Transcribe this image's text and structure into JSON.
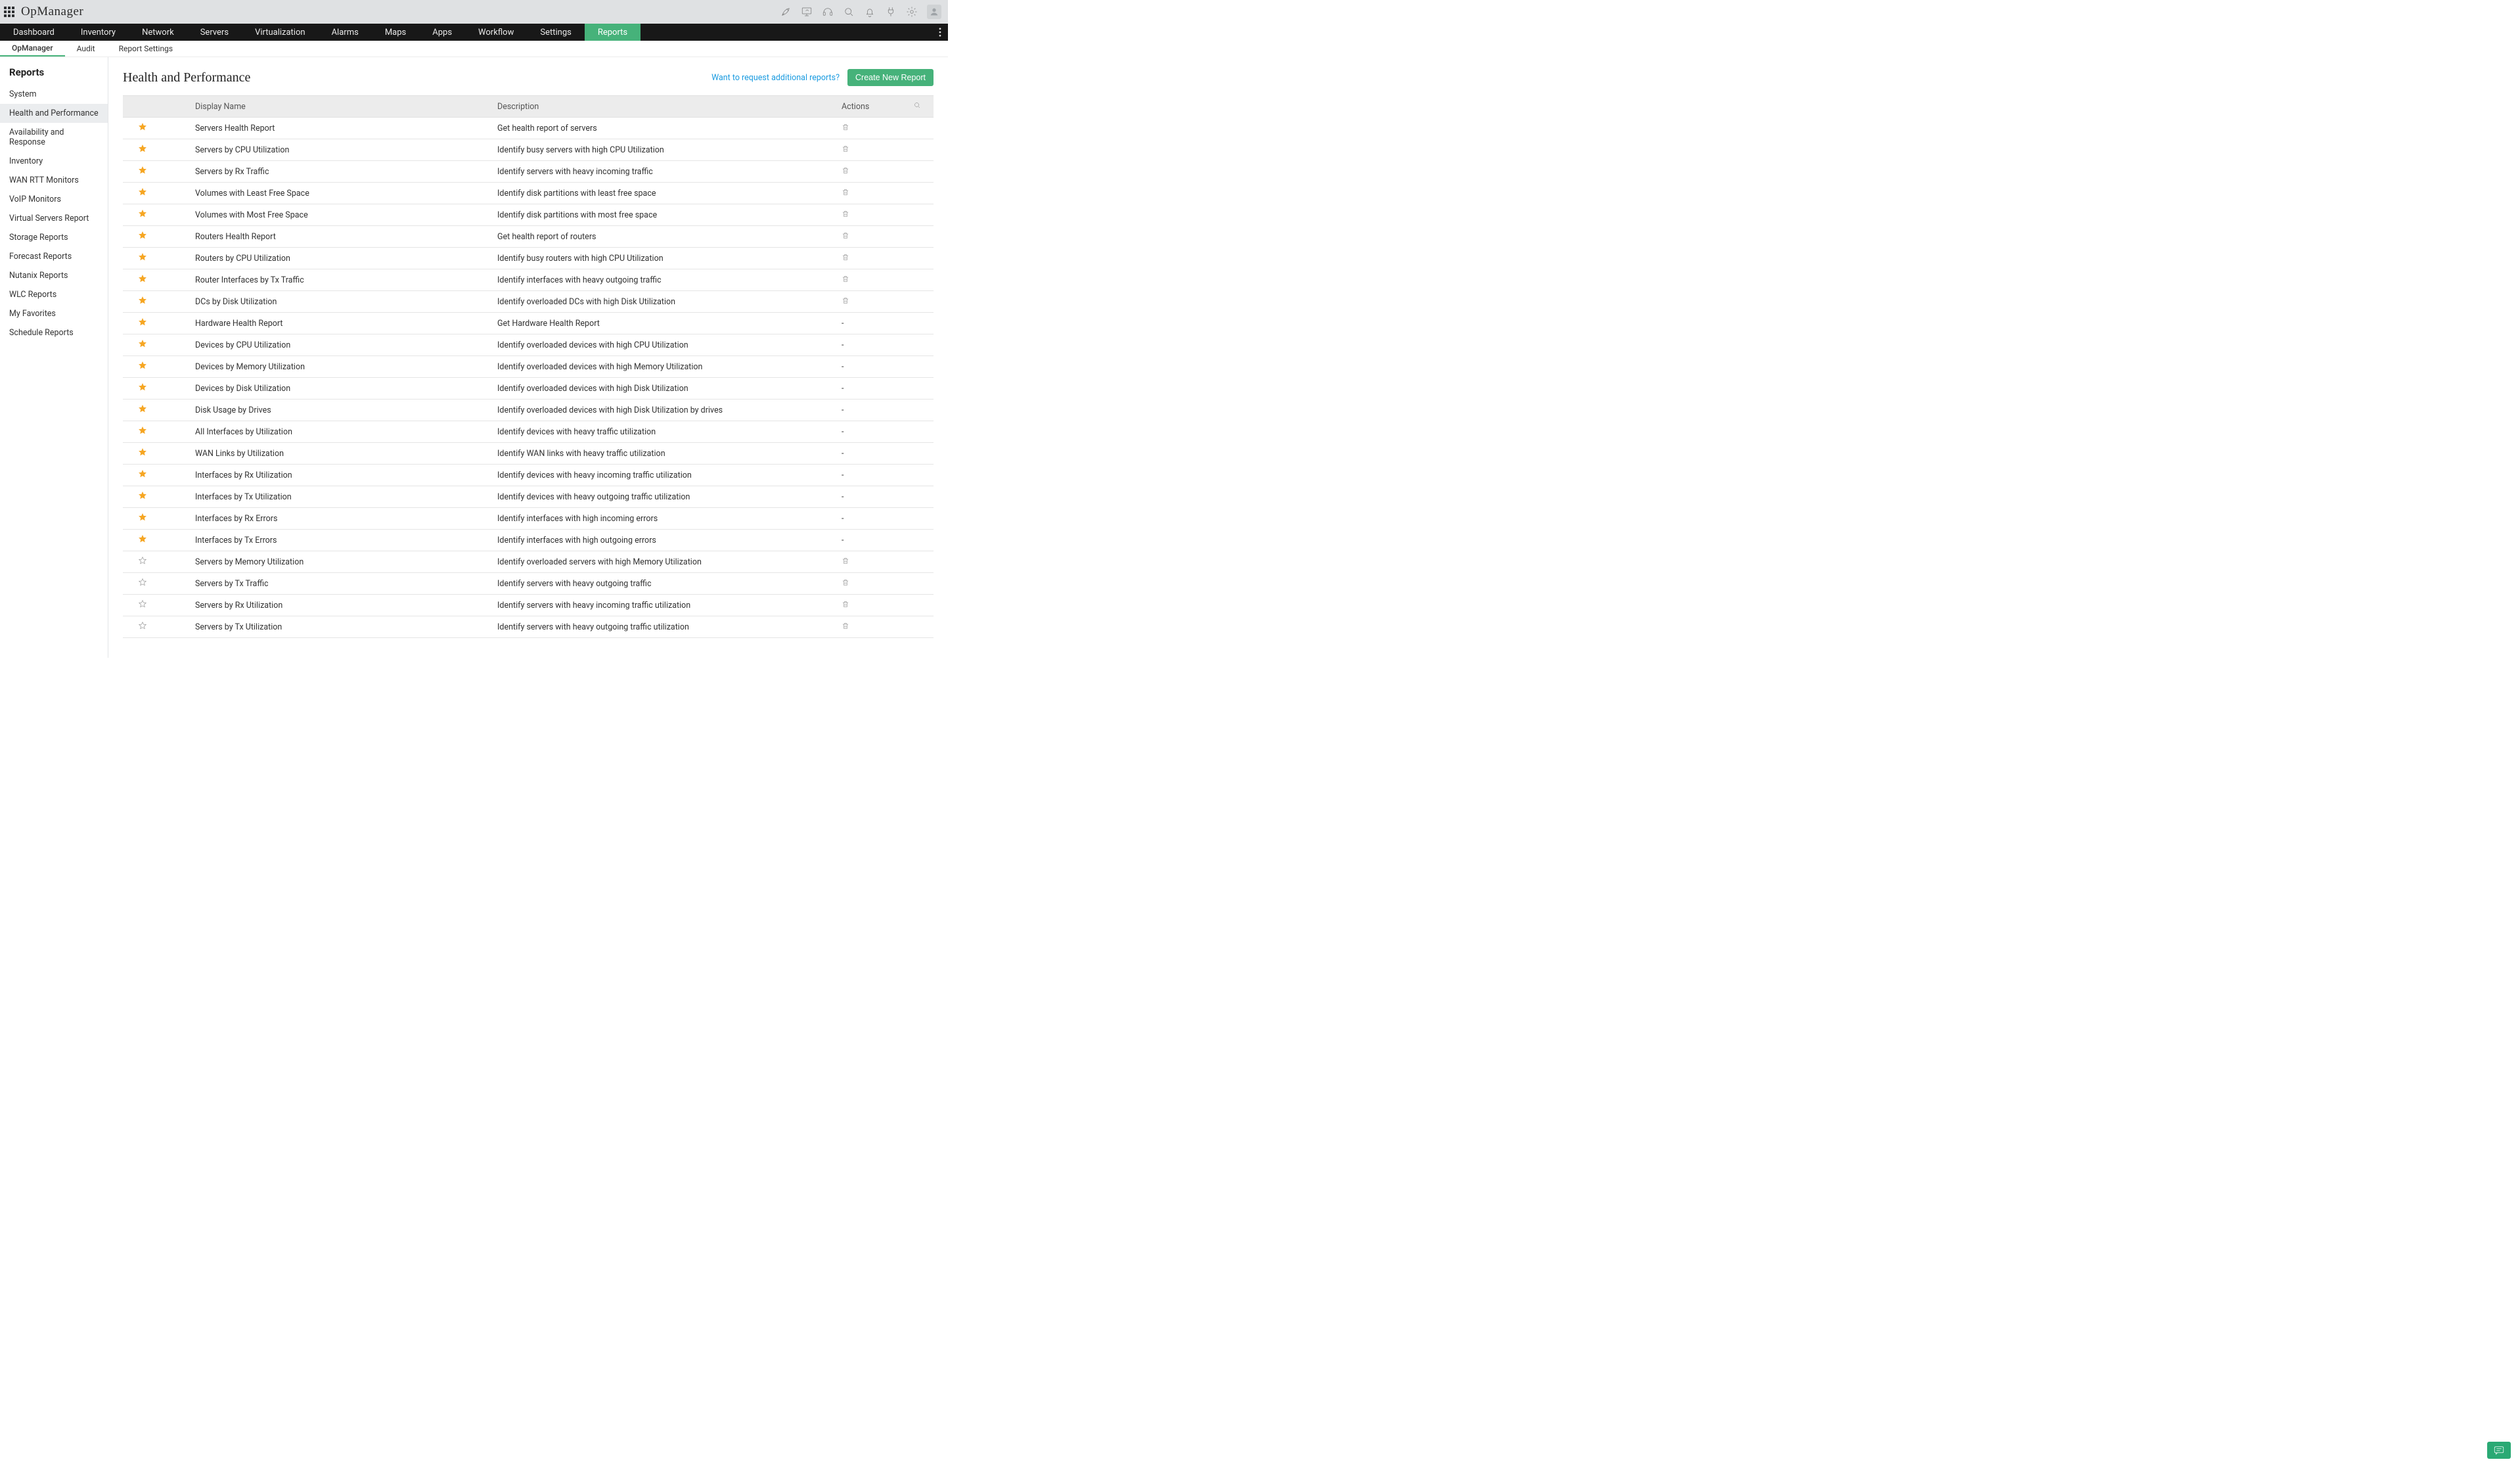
{
  "app": {
    "title": "OpManager"
  },
  "topbar_icons": [
    "rocket-icon",
    "monitor-icon",
    "headset-icon",
    "search-icon",
    "bell-icon",
    "plug-icon",
    "gear-icon",
    "user-icon"
  ],
  "mainnav": {
    "items": [
      "Dashboard",
      "Inventory",
      "Network",
      "Servers",
      "Virtualization",
      "Alarms",
      "Maps",
      "Apps",
      "Workflow",
      "Settings",
      "Reports"
    ],
    "active": "Reports"
  },
  "subnav": {
    "items": [
      "OpManager",
      "Audit",
      "Report Settings"
    ],
    "active": "OpManager"
  },
  "sidebar": {
    "title": "Reports",
    "items": [
      "System",
      "Health and Performance",
      "Availability and Response",
      "Inventory",
      "WAN RTT Monitors",
      "VoIP Monitors",
      "Virtual Servers Report",
      "Storage Reports",
      "Forecast Reports",
      "Nutanix Reports",
      "WLC Reports",
      "My Favorites",
      "Schedule Reports"
    ],
    "active": "Health and Performance"
  },
  "page": {
    "title": "Health and Performance",
    "request_link": "Want to request additional reports?",
    "create_btn": "Create New Report"
  },
  "table": {
    "columns": {
      "name": "Display Name",
      "desc": "Description",
      "actions": "Actions"
    },
    "rows": [
      {
        "fav": true,
        "name": "Servers Health Report",
        "desc": "Get health report of servers",
        "del": true
      },
      {
        "fav": true,
        "name": "Servers by CPU Utilization",
        "desc": "Identify busy servers with high CPU Utilization",
        "del": true
      },
      {
        "fav": true,
        "name": "Servers by Rx Traffic",
        "desc": "Identify servers with heavy incoming traffic",
        "del": true
      },
      {
        "fav": true,
        "name": "Volumes with Least Free Space",
        "desc": "Identify disk partitions with least free space",
        "del": true
      },
      {
        "fav": true,
        "name": "Volumes with Most Free Space",
        "desc": "Identify disk partitions with most free space",
        "del": true
      },
      {
        "fav": true,
        "name": "Routers Health Report",
        "desc": "Get health report of routers",
        "del": true
      },
      {
        "fav": true,
        "name": "Routers by CPU Utilization",
        "desc": "Identify busy routers with high CPU Utilization",
        "del": true
      },
      {
        "fav": true,
        "name": "Router Interfaces by Tx Traffic",
        "desc": "Identify interfaces with heavy outgoing traffic",
        "del": true
      },
      {
        "fav": true,
        "name": "DCs by Disk Utilization",
        "desc": "Identify overloaded DCs with high Disk Utilization",
        "del": true
      },
      {
        "fav": true,
        "name": "Hardware Health Report",
        "desc": "Get Hardware Health Report",
        "del": false
      },
      {
        "fav": true,
        "name": "Devices by CPU Utilization",
        "desc": "Identify overloaded devices with high CPU Utilization",
        "del": false
      },
      {
        "fav": true,
        "name": "Devices by Memory Utilization",
        "desc": "Identify overloaded devices with high Memory Utilization",
        "del": false
      },
      {
        "fav": true,
        "name": "Devices by Disk Utilization",
        "desc": "Identify overloaded devices with high Disk Utilization",
        "del": false
      },
      {
        "fav": true,
        "name": "Disk Usage by Drives",
        "desc": "Identify overloaded devices with high Disk Utilization by drives",
        "del": false
      },
      {
        "fav": true,
        "name": "All Interfaces by Utilization",
        "desc": "Identify devices with heavy traffic utilization",
        "del": false
      },
      {
        "fav": true,
        "name": "WAN Links by Utilization",
        "desc": "Identify WAN links with heavy traffic utilization",
        "del": false
      },
      {
        "fav": true,
        "name": "Interfaces by Rx Utilization",
        "desc": "Identify devices with heavy incoming traffic utilization",
        "del": false
      },
      {
        "fav": true,
        "name": "Interfaces by Tx Utilization",
        "desc": "Identify devices with heavy outgoing traffic utilization",
        "del": false
      },
      {
        "fav": true,
        "name": "Interfaces by Rx Errors",
        "desc": "Identify interfaces with high incoming errors",
        "del": false
      },
      {
        "fav": true,
        "name": "Interfaces by Tx Errors",
        "desc": "Identify interfaces with high outgoing errors",
        "del": false
      },
      {
        "fav": false,
        "name": "Servers by Memory Utilization",
        "desc": "Identify overloaded servers with high Memory Utilization",
        "del": true
      },
      {
        "fav": false,
        "name": "Servers by Tx Traffic",
        "desc": "Identify servers with heavy outgoing traffic",
        "del": true
      },
      {
        "fav": false,
        "name": "Servers by Rx Utilization",
        "desc": "Identify servers with heavy incoming traffic utilization",
        "del": true
      },
      {
        "fav": false,
        "name": "Servers by Tx Utilization",
        "desc": "Identify servers with heavy outgoing traffic utilization",
        "del": true
      }
    ]
  }
}
